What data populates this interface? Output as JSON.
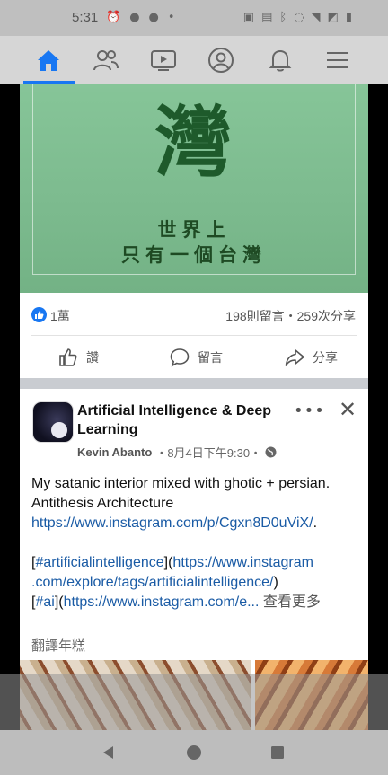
{
  "status_bar": {
    "time": "5:31",
    "left_icons": [
      "alarm-icon",
      "android-icon",
      "android-icon",
      "dot-icon"
    ],
    "right_icons": [
      "cast-icon",
      "data-saver-icon",
      "bluetooth-icon",
      "mute-icon",
      "wifi-icon",
      "no-sim-icon",
      "battery-icon"
    ]
  },
  "nav": {
    "items": [
      {
        "name": "home",
        "icon": "home-icon",
        "active": true
      },
      {
        "name": "friends",
        "icon": "friends-icon",
        "active": false
      },
      {
        "name": "watch",
        "icon": "watch-icon",
        "active": false
      },
      {
        "name": "profile",
        "icon": "profile-icon",
        "active": false
      },
      {
        "name": "notifications",
        "icon": "bell-icon",
        "active": false
      },
      {
        "name": "menu",
        "icon": "menu-icon",
        "active": false
      }
    ],
    "accent": "#1877f2"
  },
  "hero": {
    "big_char": "灣",
    "line1": "世界上",
    "line2": "只有一個台灣",
    "bg_color": "#7dbb8f"
  },
  "post1": {
    "reaction_count": "1萬",
    "stats": "198則留言・259次分享",
    "actions": {
      "like": "讚",
      "comment": "留言",
      "share": "分享"
    }
  },
  "post2": {
    "page_name": "Artificial Intelligence & Deep Learning",
    "author": "Kevin Abanto",
    "timestamp": "・8月4日下午9:30・",
    "text_line1": "My satanic interior mixed with ghotic + persian.",
    "text_line2": "Antithesis Architecture",
    "link1": "https://www.instagram.com/p/Cgxn8D0uViX/",
    "link1_suffix": ".",
    "tag1_prefix": "[",
    "tag1": "#artificialintelligence",
    "tag1_mid": "](",
    "tag1_link_a": "https://www.instagram",
    "tag1_link_b": ".com/explore/tags/artificialintelligence/",
    "tag1_suffix": ")",
    "tag2_prefix": "[",
    "tag2": "#ai",
    "tag2_mid": "](",
    "tag2_link": "https://www.instagram.com/e...",
    "see_more": "查看更多",
    "translate": "翻譯年糕"
  }
}
